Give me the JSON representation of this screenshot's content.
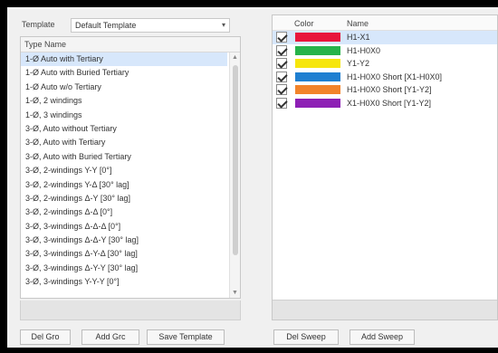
{
  "template": {
    "label": "Template",
    "selected": "Default Template",
    "dropdown_icon": "chevron-down-icon"
  },
  "type_list": {
    "header": "Type Name",
    "items": [
      "1-Ø Auto with Tertiary",
      "1-Ø Auto with Buried Tertiary",
      "1-Ø Auto w/o Tertiary",
      "1-Ø, 2 windings",
      "1-Ø, 3 windings",
      "3-Ø, Auto without Tertiary",
      "3-Ø, Auto with Tertiary",
      "3-Ø, Auto with Buried Tertiary",
      "3-Ø, 2-windings Y-Y [0°]",
      "3-Ø, 2-windings Y-Δ [30° lag]",
      "3-Ø, 2-windings Δ-Y [30° lag]",
      "3-Ø, 2-windings Δ-Δ [0°]",
      "3-Ø, 3-windings Δ-Δ-Δ [0°]",
      "3-Ø, 3-windings Δ-Δ-Y [30° lag]",
      "3-Ø, 3-windings Δ-Y-Δ [30° lag]",
      "3-Ø, 3-windings Δ-Y-Y [30° lag]",
      "3-Ø, 3-windings Y-Y-Y [0°]"
    ],
    "selected_index": 0
  },
  "left_buttons": {
    "del_group": "Del Gro",
    "add_group": "Add Grc",
    "save_template": "Save Template"
  },
  "sweep_table": {
    "columns": [
      "Color",
      "Name"
    ],
    "rows": [
      {
        "checked": true,
        "color": "#e8163c",
        "name": "H1-X1"
      },
      {
        "checked": true,
        "color": "#26b34a",
        "name": "H1-H0X0"
      },
      {
        "checked": true,
        "color": "#f6e60c",
        "name": "Y1-Y2"
      },
      {
        "checked": true,
        "color": "#1f7fd1",
        "name": "H1-H0X0 Short [X1-H0X0]"
      },
      {
        "checked": true,
        "color": "#f2832a",
        "name": "H1-H0X0 Short [Y1-Y2]"
      },
      {
        "checked": true,
        "color": "#8d1fb5",
        "name": "X1-H0X0 Short [Y1-Y2]"
      }
    ],
    "selected_index": 0
  },
  "right_buttons": {
    "del_sweep": "Del Sweep",
    "add_sweep": "Add Sweep"
  }
}
